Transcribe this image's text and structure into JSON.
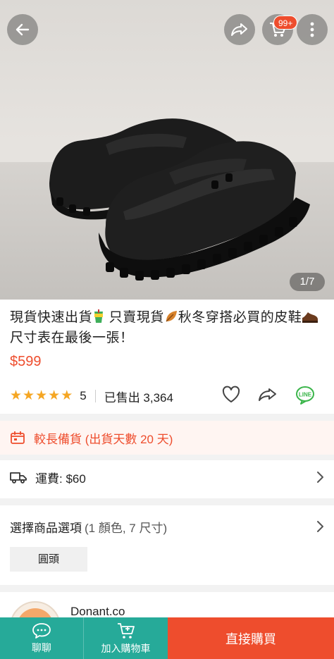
{
  "header": {
    "back_icon": "arrow-left-icon",
    "share_icon": "share-icon",
    "cart_icon": "cart-icon",
    "cart_badge": "99+",
    "more_icon": "more-vertical-icon"
  },
  "gallery": {
    "page_indicator": "1/7"
  },
  "product": {
    "title_part1": "現貨快速出貨",
    "title_part2": " 只賣現貨",
    "title_part3": "秋冬穿搭必買的皮鞋",
    "title_part4": "尺寸表在最後一張！",
    "price": "$599",
    "rating": "5",
    "rating_stars": 5,
    "sold": "已售出 3,364"
  },
  "notices": {
    "preorder": "較長備貨 (出貨天數 20 天)",
    "shipping": "運費: $60"
  },
  "options": {
    "title": "選擇商品選項",
    "summary": "(1 顏色, 7 尺寸)",
    "chip": "圓頭"
  },
  "shop": {
    "name": "Donant.co"
  },
  "bottom_bar": {
    "chat": "聊聊",
    "add_to_cart": "加入購物車",
    "buy_now": "直接購買"
  },
  "colors": {
    "accent": "#ee4d2d",
    "teal": "#26aa99",
    "star": "#f5a623"
  }
}
